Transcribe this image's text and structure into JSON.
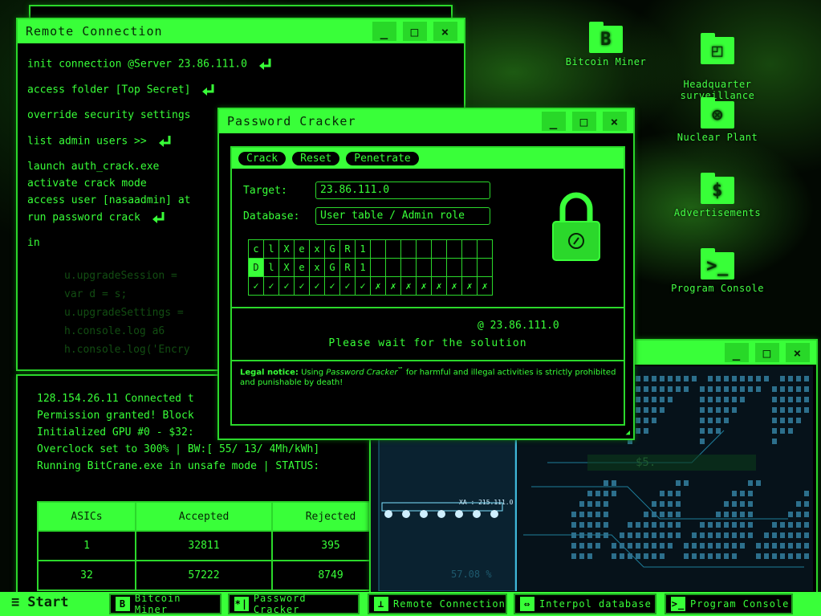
{
  "desktop_icons": [
    {
      "label": "Bitcoin Miner",
      "glyph": "B"
    },
    {
      "label": "Headquarter\nsurveillance",
      "glyph": "◰"
    },
    {
      "label": "Nuclear Plant",
      "glyph": "⊗"
    },
    {
      "label": "Advertisements",
      "glyph": "$"
    },
    {
      "label": "Program Console",
      "glyph": ">_"
    }
  ],
  "remote": {
    "title": "Remote Connection",
    "lines": [
      "init connection @Server 23.86.111.0",
      "access folder [Top Secret]",
      "override security settings",
      "list admin users >>",
      "launch auth_crack.exe",
      "activate crack mode",
      "access user [nasaadmin] at",
      "run password crack",
      "in"
    ],
    "code_lines": [
      "u.upgradeSession = ",
      "var d = s;",
      "u.upgradeSettings =",
      "h.console.log a6",
      "h.console.log('Encry"
    ]
  },
  "miner": {
    "lines": [
      "128.154.26.11 Connected t",
      "Permission granted! Block",
      "Initialized GPU #0 - $32:",
      "Overclock set to 300% | BW:[ 55/ 13/ 4Mh/kWh]",
      "Running BitCrane.exe in unsafe mode | STATUS:"
    ],
    "table": {
      "headers": [
        "ASICs",
        "Accepted",
        "Rejected"
      ],
      "rows": [
        [
          "1",
          "32811",
          "395"
        ],
        [
          "32",
          "57222",
          "8749"
        ]
      ]
    }
  },
  "cracker": {
    "title": "Password Cracker",
    "buttons": [
      "Crack",
      "Reset",
      "Penetrate"
    ],
    "target_label": "Target:",
    "target_value": "23.86.111.0",
    "database_label": "Database:",
    "database_value": "User table / Admin role",
    "row1": [
      "c",
      "l",
      "X",
      "e",
      "x",
      "G",
      "R",
      "1",
      "",
      "",
      "",
      "",
      "",
      "",
      "",
      ""
    ],
    "row2": [
      "D",
      "l",
      "X",
      "e",
      "x",
      "G",
      "R",
      "1",
      "",
      "",
      "",
      "",
      "",
      "",
      "",
      ""
    ],
    "row3": [
      "✓",
      "✓",
      "✓",
      "✓",
      "✓",
      "✓",
      "✓",
      "✓",
      "✗",
      "✗",
      "✗",
      "✗",
      "✗",
      "✗",
      "✗",
      "✗"
    ],
    "at_line": "@ 23.86.111.0",
    "wait": "Please wait for the solution",
    "legal_bold": "Legal notice:",
    "legal_text_1": " Using ",
    "legal_italic": "Password Cracker",
    "legal_tm": "℠",
    "legal_text_2": " for harmful and illegal activities is strictly prohibited and punishable by death!"
  },
  "map_window": {
    "overlay_text": "XA : 215.111.0",
    "bottom_text": "57.08 %",
    "s_text": "$5."
  },
  "taskbar": {
    "start": "Start",
    "items": [
      {
        "label": "Bitcoin Miner",
        "glyph": "B"
      },
      {
        "label": "Password Cracker",
        "glyph": "*|"
      },
      {
        "label": "Remote Connection",
        "glyph": "⊥"
      },
      {
        "label": "Interpol database",
        "glyph": "⇔"
      },
      {
        "label": "Program Console",
        "glyph": ">_"
      }
    ]
  },
  "controls": {
    "minimize": "_",
    "maximize": "□",
    "close": "×"
  }
}
